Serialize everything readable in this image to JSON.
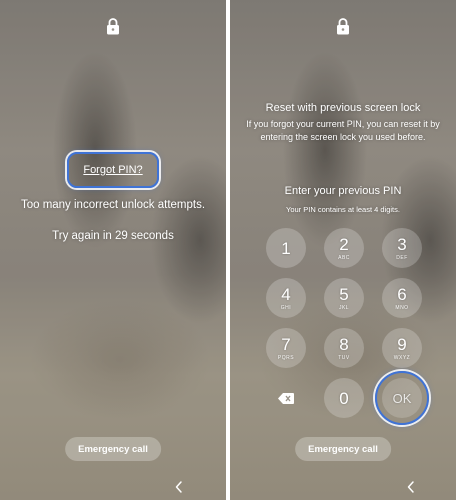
{
  "left": {
    "forgot_label": "Forgot PIN?",
    "message_attempts": "Too many incorrect unlock attempts.",
    "message_retry": "Try again in 29 seconds",
    "emergency_label": "Emergency call"
  },
  "right": {
    "title": "Reset with previous screen lock",
    "description": "If you forgot your current PIN, you can reset it by entering the screen lock you used before.",
    "prompt": "Enter your previous PIN",
    "hint": "Your PIN contains at least 4 digits.",
    "keys": [
      {
        "num": "1",
        "sub": ""
      },
      {
        "num": "2",
        "sub": "ABC"
      },
      {
        "num": "3",
        "sub": "DEF"
      },
      {
        "num": "4",
        "sub": "GHI"
      },
      {
        "num": "5",
        "sub": "JKL"
      },
      {
        "num": "6",
        "sub": "MNO"
      },
      {
        "num": "7",
        "sub": "PQRS"
      },
      {
        "num": "8",
        "sub": "TUV"
      },
      {
        "num": "9",
        "sub": "WXYZ"
      },
      {
        "num": "0",
        "sub": ""
      }
    ],
    "ok_label": "OK",
    "emergency_label": "Emergency call"
  },
  "icons": {
    "lock": "lock-icon",
    "backspace": "backspace-icon",
    "back": "back-chevron-icon"
  },
  "colors": {
    "highlight": "#3f73d6",
    "text": "#ffffff"
  }
}
